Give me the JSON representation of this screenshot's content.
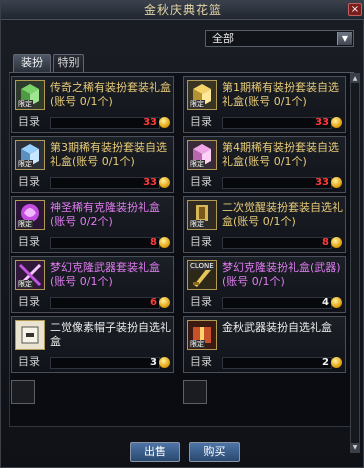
{
  "window": {
    "title": "金秋庆典花篮",
    "close_label": "×"
  },
  "filter": {
    "selected": "全部",
    "arrow": "▼"
  },
  "tabs": [
    {
      "label": "装扮",
      "active": true
    },
    {
      "label": "特别",
      "active": false
    }
  ],
  "items": [
    {
      "name": "传奇之稀有装扮套装礼盒(账号 0/1个)",
      "category": "目录",
      "price": "33",
      "price_color": "red",
      "icon": "rare-costume-box-icon",
      "tag": "限定"
    },
    {
      "name": "第1期稀有装扮套装自选礼盒(账号 0/1个)",
      "category": "目录",
      "price": "33",
      "price_color": "red",
      "icon": "rare-costume-box-icon",
      "tag": "限定"
    },
    {
      "name": "第3期稀有装扮套装自选礼盒(账号 0/1个)",
      "category": "目录",
      "price": "33",
      "price_color": "red",
      "icon": "rare-costume-box-icon",
      "tag": "限定"
    },
    {
      "name": "第4期稀有装扮套装自选礼盒(账号 0/1个)",
      "category": "目录",
      "price": "33",
      "price_color": "red",
      "icon": "rare-costume-box-icon",
      "tag": "限定"
    },
    {
      "name": "神圣稀有克隆装扮礼盒(账号 0/2个)",
      "category": "目录",
      "price": "8",
      "price_color": "red",
      "icon": "divine-clone-box-icon",
      "tag": "限定"
    },
    {
      "name": "二次觉醒装扮套装自选礼盒(账号 0/1个)",
      "category": "目录",
      "price": "8",
      "price_color": "red",
      "icon": "awakening-costume-box-icon",
      "tag": "限定"
    },
    {
      "name": "梦幻克隆武器套装礼盒(账号 0/1个)",
      "category": "目录",
      "price": "6",
      "price_color": "red",
      "icon": "dream-weapon-box-icon",
      "tag": "限定"
    },
    {
      "name": "梦幻克隆装扮礼盒(武器)(账号 0/1个)",
      "category": "目录",
      "price": "4",
      "price_color": "white",
      "icon": "clone-costume-box-icon",
      "tag": "CLONE"
    },
    {
      "name": "二觉像素帽子装扮自选礼盒",
      "category": "目录",
      "price": "3",
      "price_color": "white",
      "icon": "pixel-hat-box-icon",
      "tag": ""
    },
    {
      "name": "金秋武器装扮自选礼盒",
      "category": "目录",
      "price": "2",
      "price_color": "white",
      "icon": "autumn-weapon-box-icon",
      "tag": "限定"
    }
  ],
  "buttons": {
    "sell": "出售",
    "buy": "购买"
  },
  "colors": {
    "name_gold": "#e8cb78",
    "name_purple": "#e07cf0",
    "price_red": "#ff3b3b",
    "button_blue": "#3f6496"
  }
}
